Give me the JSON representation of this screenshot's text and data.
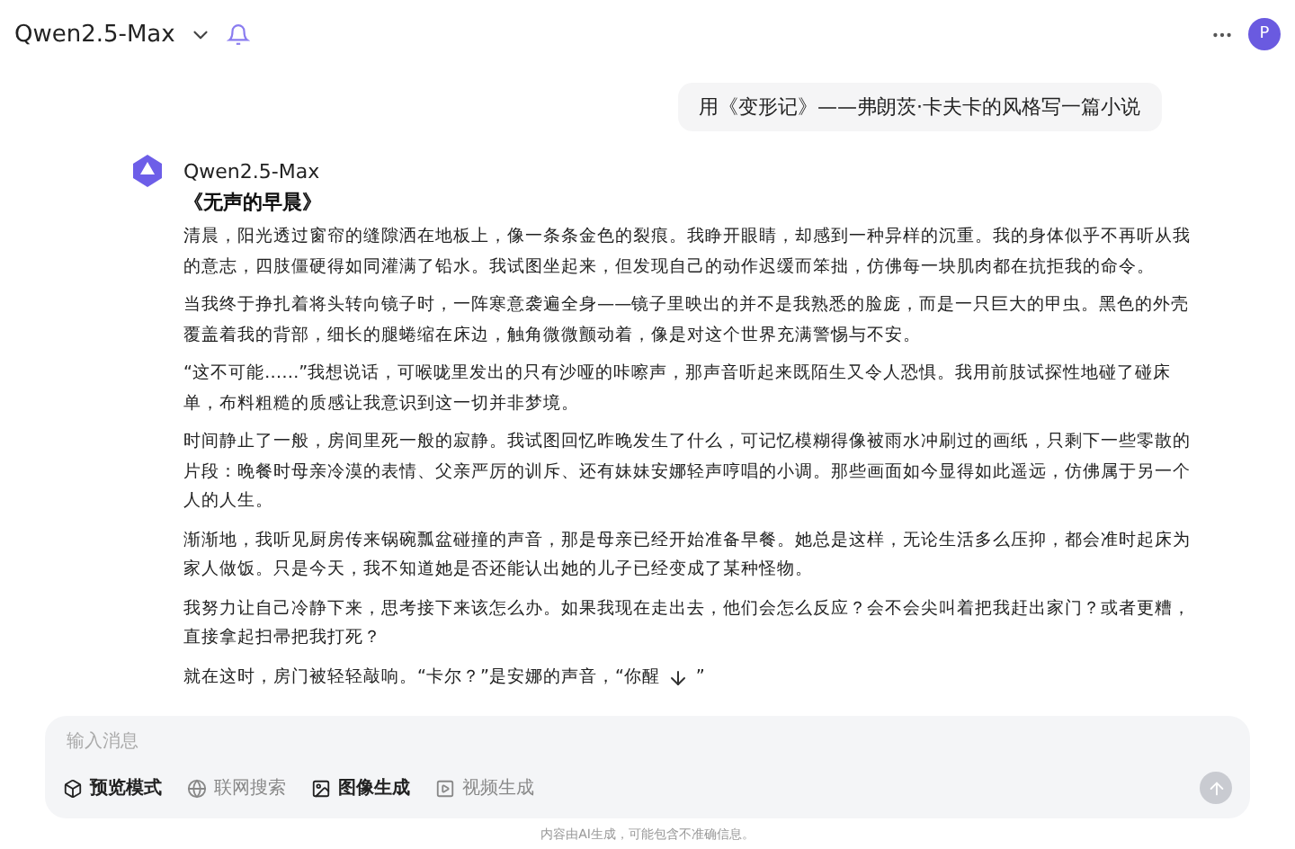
{
  "header": {
    "model": "Qwen2.5-Max",
    "avatar": "P"
  },
  "user_message": "用《变形记》——弗朗茨·卡夫卡的风格写一篇小说",
  "reply": {
    "author": "Qwen2.5-Max",
    "title": "《无声的早晨》",
    "paragraphs": [
      "清晨，阳光透过窗帘的缝隙洒在地板上，像一条条金色的裂痕。我睁开眼睛，却感到一种异样的沉重。我的身体似乎不再听从我的意志，四肢僵硬得如同灌满了铅水。我试图坐起来，但发现自己的动作迟缓而笨拙，仿佛每一块肌肉都在抗拒我的命令。",
      "当我终于挣扎着将头转向镜子时，一阵寒意袭遍全身——镜子里映出的并不是我熟悉的脸庞，而是一只巨大的甲虫。黑色的外壳覆盖着我的背部，细长的腿蜷缩在床边，触角微微颤动着，像是对这个世界充满警惕与不安。",
      "“这不可能……”我想说话，可喉咙里发出的只有沙哑的咔嚓声，那声音听起来既陌生又令人恐惧。我用前肢试探性地碰了碰床单，布料粗糙的质感让我意识到这一切并非梦境。",
      "时间静止了一般，房间里死一般的寂静。我试图回忆昨晚发生了什么，可记忆模糊得像被雨水冲刷过的画纸，只剩下一些零散的片段：晚餐时母亲冷漠的表情、父亲严厉的训斥、还有妹妹安娜轻声哼唱的小调。那些画面如今显得如此遥远，仿佛属于另一个人的人生。",
      "渐渐地，我听见厨房传来锅碗瓢盆碰撞的声音，那是母亲已经开始准备早餐。她总是这样，无论生活多么压抑，都会准时起床为家人做饭。只是今天，我不知道她是否还能认出她的儿子已经变成了某种怪物。",
      "我努力让自己冷静下来，思考接下来该怎么办。如果我现在走出去，他们会怎么反应？会不会尖叫着把我赶出家门？或者更糟，直接拿起扫帚把我打死？"
    ],
    "last_line": "就在这时，房门被轻轻敲响。“卡尔？”是安娜的声音，“你醒",
    "last_line_end": "”"
  },
  "composer": {
    "placeholder": "输入消息",
    "tools": [
      {
        "label": "预览模式",
        "kind": "mode",
        "on": true
      },
      {
        "label": "联网搜索",
        "kind": "search",
        "on": false
      },
      {
        "label": "图像生成",
        "kind": "image",
        "on": true
      },
      {
        "label": "视频生成",
        "kind": "video",
        "on": false
      }
    ]
  },
  "disclaimer": "内容由AI生成，可能包含不准确信息。"
}
